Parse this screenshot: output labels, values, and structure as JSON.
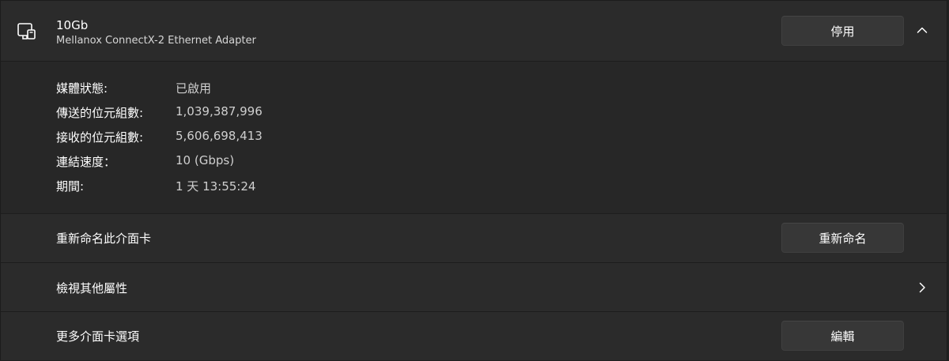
{
  "adapter": {
    "name": "10Gb",
    "description": "Mellanox ConnectX-2 Ethernet Adapter",
    "icon": "network-adapter-icon",
    "disable_label": "停用",
    "expanded": true
  },
  "properties": [
    {
      "key": "媒體狀態:",
      "value": "已啟用"
    },
    {
      "key": "傳送的位元組數:",
      "value": "1,039,387,996"
    },
    {
      "key": "接收的位元組數:",
      "value": "5,606,698,413"
    },
    {
      "key": "連結速度：",
      "value": "10 (Gbps)"
    },
    {
      "key": "期間:",
      "value": "1 天 13:55:24"
    }
  ],
  "rename": {
    "label": "重新命名此介面卡",
    "button_label": "重新命名"
  },
  "more_properties": {
    "label": "檢視其他屬性"
  },
  "more_options": {
    "label": "更多介面卡選項",
    "button_label": "編輯"
  },
  "colors": {
    "background": "#202020",
    "card": "#2b2b2b",
    "details_background": "#272727",
    "button": "#373737",
    "text": "#ffffff",
    "secondary_text": "#cfcfcf"
  }
}
